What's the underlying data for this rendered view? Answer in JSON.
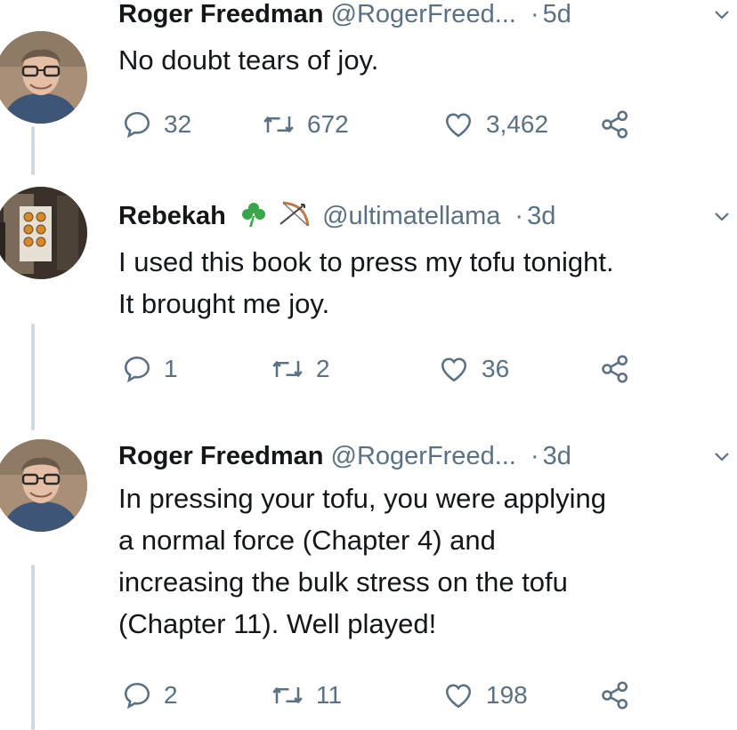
{
  "tweets": [
    {
      "display_name": "Roger Freedman",
      "handle": "@RogerFreed...",
      "separator": "·",
      "time": "5d",
      "text_lines": [
        "No doubt tears of joy."
      ],
      "reply_count": "32",
      "retweet_count": "672",
      "like_count": "3,462",
      "avatar_icon": "man-with-glasses-avatar"
    },
    {
      "display_name": "Rebekah",
      "name_emojis": [
        "shamrock-icon",
        "bow-and-arrow-icon"
      ],
      "handle": "@ultimatellama",
      "separator": "·",
      "time": "3d",
      "text_lines": [
        "I used this book to press my tofu tonight.",
        "It brought me joy."
      ],
      "reply_count": "1",
      "retweet_count": "2",
      "like_count": "36",
      "avatar_icon": "bookshelf-photo-avatar"
    },
    {
      "display_name": "Roger Freedman",
      "handle": "@RogerFreed...",
      "separator": "·",
      "time": "3d",
      "text_lines": [
        "In pressing your tofu, you were applying",
        "a normal force (Chapter 4) and",
        "increasing the bulk stress on the tofu",
        "(Chapter 11). Well played!"
      ],
      "reply_count": "2",
      "retweet_count": "11",
      "like_count": "198",
      "avatar_icon": "man-with-glasses-avatar"
    }
  ],
  "colors": {
    "text": "#14171a",
    "secondary": "#5b7083",
    "thread_line": "#cfd9de",
    "shamrock": "#3aa64a"
  }
}
